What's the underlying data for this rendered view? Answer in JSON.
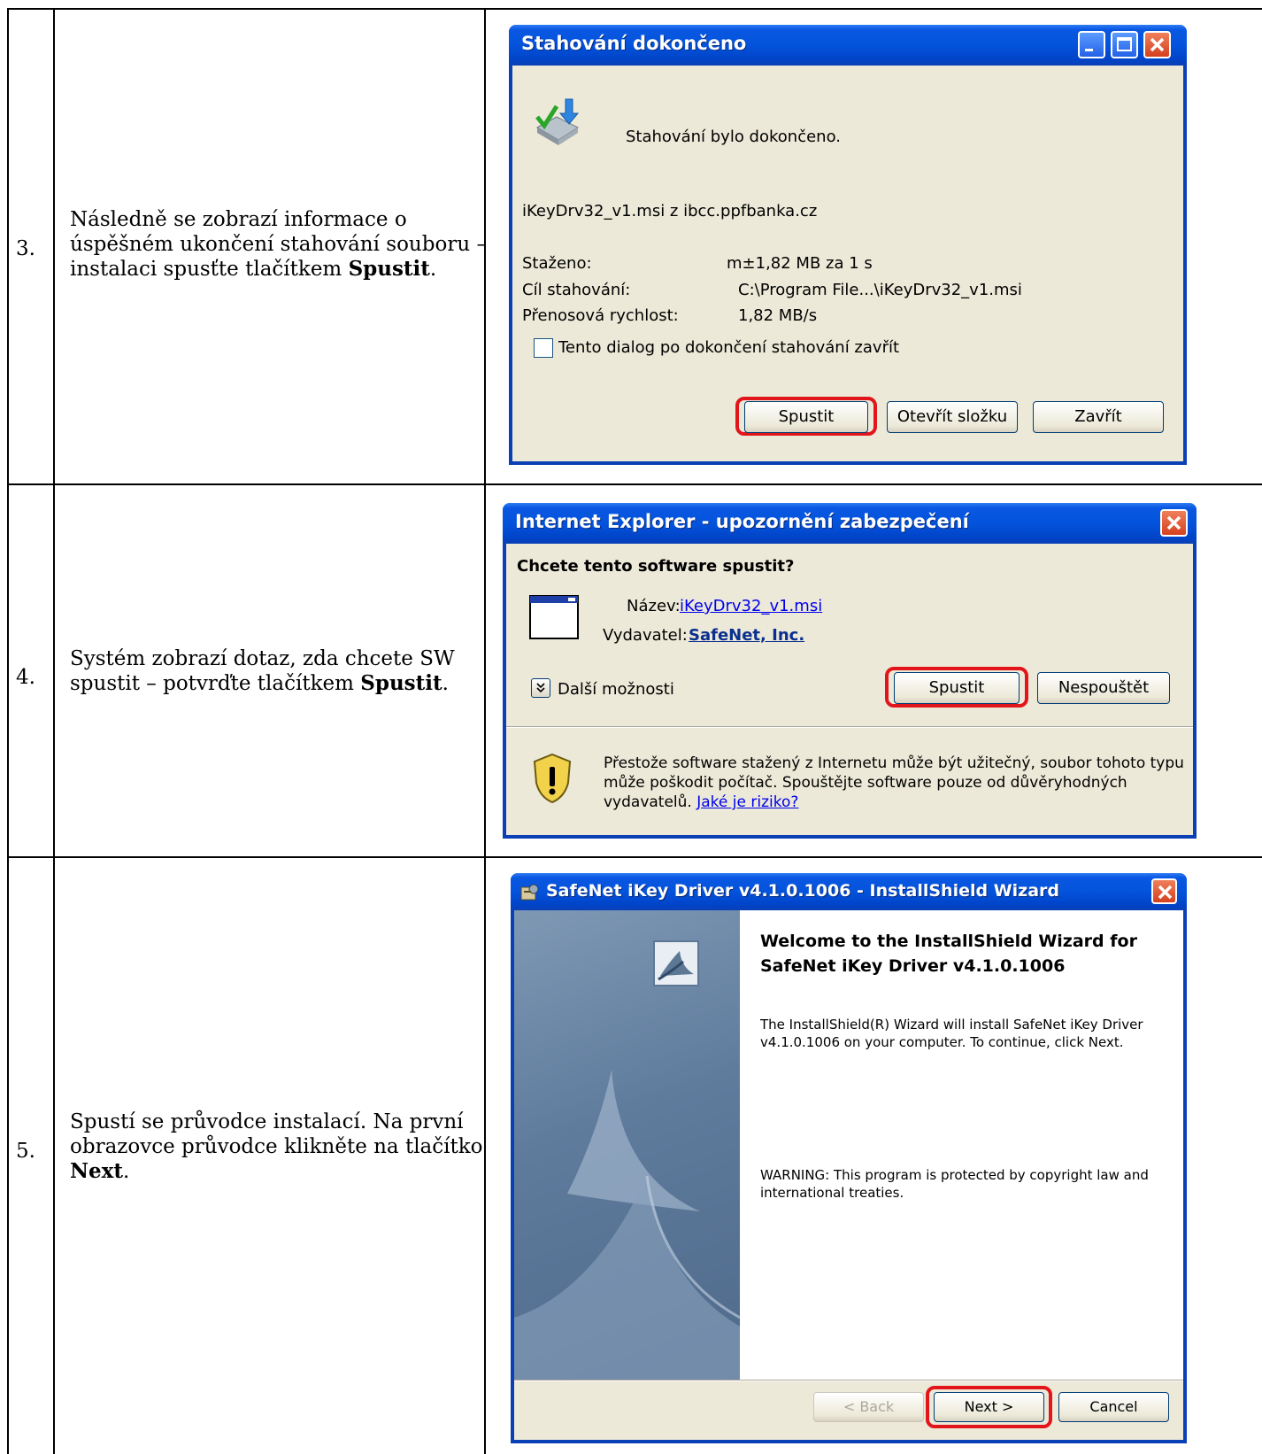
{
  "rows": [
    {
      "number": "3.",
      "description": {
        "part1": "Následně se zobrazí informace o úspěšném ukončení stahování souboru – instalaci spusťte tlačítkem ",
        "bold": "Spustit",
        "part2": "."
      }
    },
    {
      "number": "4.",
      "description": {
        "part1": "Systém zobrazí dotaz, zda chcete SW spustit – potvrďte tlačítkem ",
        "bold": "Spustit",
        "part2": "."
      }
    },
    {
      "number": "5.",
      "description": {
        "part1": "Spustí se průvodce instalací. Na první obrazovce průvodce klikněte na tlačítko ",
        "bold": "Next",
        "part2": "."
      }
    }
  ],
  "download_dialog": {
    "title": "Stahování dokončeno",
    "message": "Stahování bylo dokončeno.",
    "file_line": "iKeyDrv32_v1.msi z ibcc.ppfbanka.cz",
    "fields": [
      {
        "label": "Staženo:",
        "value": "m±1,82 MB za 1 s"
      },
      {
        "label": "Cíl stahování:",
        "value": "C:\\Program File...\\iKeyDrv32_v1.msi"
      },
      {
        "label": "Přenosová rychlost:",
        "value": "1,82 MB/s"
      }
    ],
    "checkbox_label": "Tento dialog po dokončení stahování zavřít",
    "buttons": {
      "run": "Spustit",
      "open_folder": "Otevřít složku",
      "close": "Zavřít"
    }
  },
  "security_dialog": {
    "title": "Internet Explorer - upozornění zabezpečení",
    "question": "Chcete tento software spustit?",
    "name_label": "Název:",
    "name_value": "iKeyDrv32_v1.msi",
    "publisher_label": "Vydavatel:",
    "publisher_value": "SafeNet, Inc.",
    "more_options": "Další možnosti",
    "buttons": {
      "run": "Spustit",
      "dont_run": "Nespouštět"
    },
    "warning_line1": "Přestože software stažený z Internetu může být užitečný, soubor tohoto typu",
    "warning_line2": "může poškodit počítač. Spouštějte software pouze od důvěryhodných",
    "warning_line3": "vydavatelů. ",
    "risk_link": "Jaké je riziko?"
  },
  "wizard_dialog": {
    "title": "SafeNet iKey Driver v4.1.0.1006 - InstallShield Wizard",
    "heading_line1": "Welcome to the InstallShield Wizard for",
    "heading_line2": "SafeNet iKey Driver v4.1.0.1006",
    "body_line1": "The InstallShield(R) Wizard will install SafeNet iKey Driver",
    "body_line2": "v4.1.0.1006 on your computer. To continue, click Next.",
    "warning_line1": "WARNING: This program is protected by copyright law and",
    "warning_line2": "international treaties.",
    "buttons": {
      "back": "< Back",
      "next": "Next >",
      "cancel": "Cancel"
    }
  },
  "colors": {
    "xp_title_blue": "#0453dc",
    "dialog_face": "#ece9d8",
    "highlight_red": "#e2151b",
    "wizard_blue": "#5d7a9a"
  }
}
